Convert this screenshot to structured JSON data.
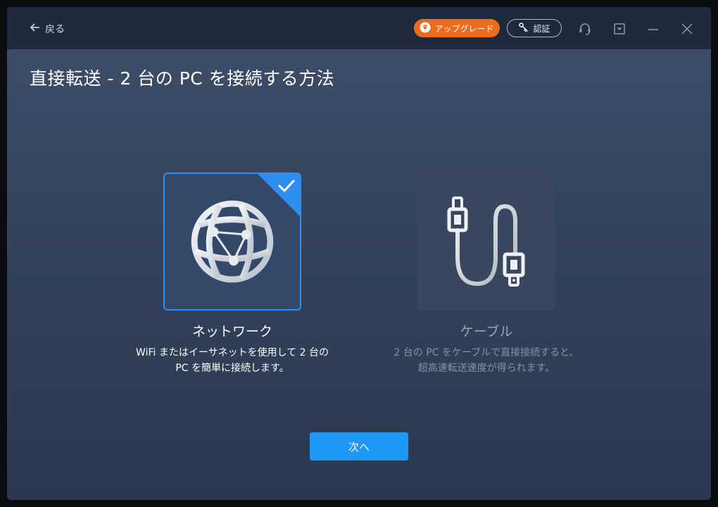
{
  "titlebar": {
    "back_label": "戻る",
    "upgrade_label": "アップグレード",
    "auth_label": "認証"
  },
  "page": {
    "title": "直接転送 - 2 台の PC を接続する方法"
  },
  "options": [
    {
      "title": "ネットワーク",
      "description_line1": "WiFi またはイーサネットを使用して 2 台の",
      "description_line2": "PC を簡単に接続します。",
      "selected": true,
      "icon": "globe-network-icon"
    },
    {
      "title": "ケーブル",
      "description_line1": "2 台の PC をケーブルで直接接続すると、",
      "description_line2": "超高速転送速度が得られます。",
      "selected": false,
      "icon": "usb-cable-icon"
    }
  ],
  "footer": {
    "next_label": "次へ"
  },
  "colors": {
    "accent": "#1e98f4",
    "upgrade": "#ee6a1c",
    "titlebar": "#1f2a3c",
    "selected_border": "#2f8ff0"
  }
}
